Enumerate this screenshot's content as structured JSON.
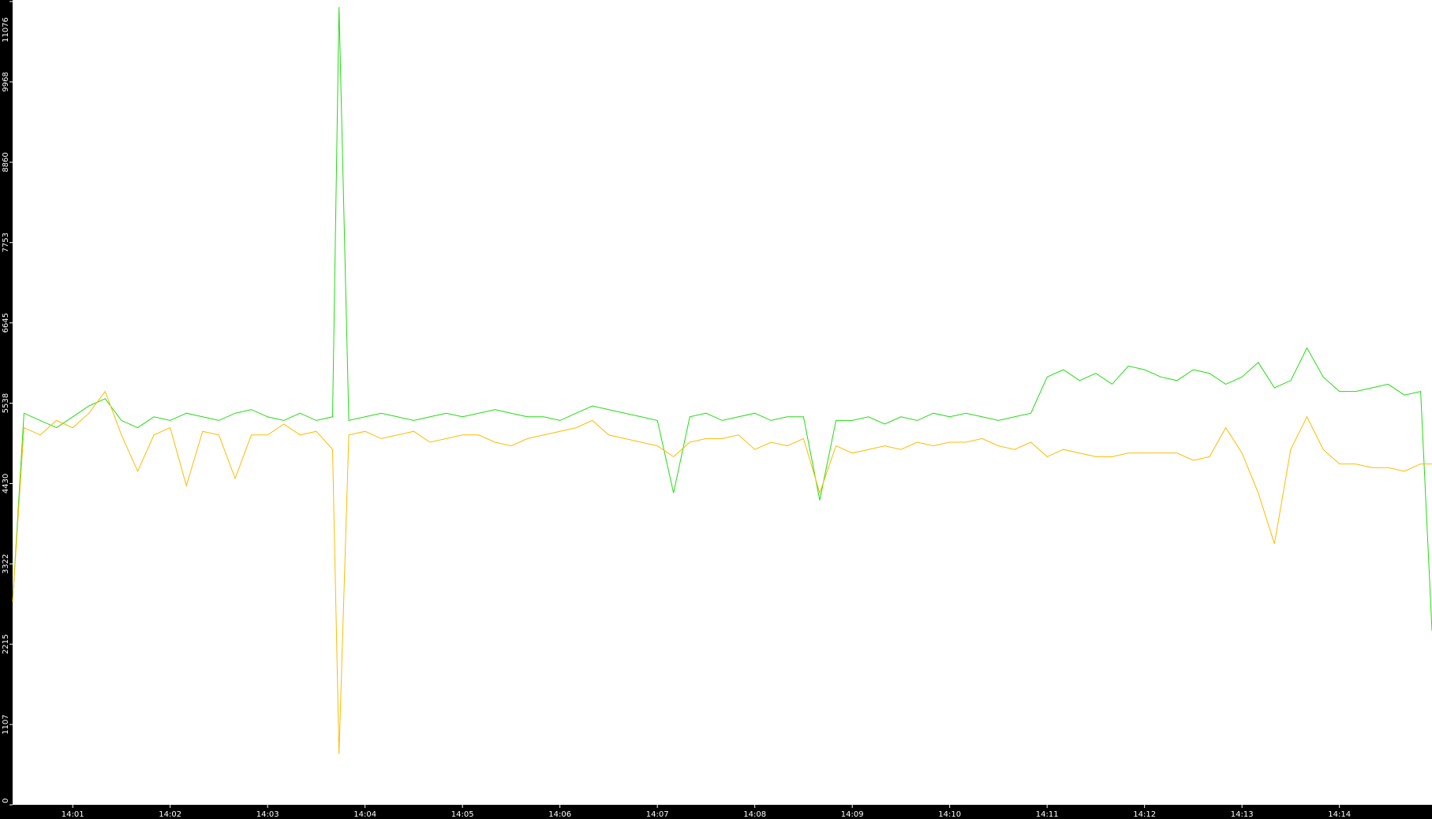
{
  "colors": {
    "background": "#ffffff",
    "axis_band": "#000000",
    "axis_text": "#ffffff",
    "series_green": "#22dd11",
    "series_orange": "#ffbb00"
  },
  "chart_data": {
    "type": "line",
    "title": "",
    "xlabel": "",
    "ylabel": "",
    "grid": false,
    "legend": "none",
    "ylim": [
      0,
      11076
    ],
    "y_ticks": [
      0,
      1107,
      2215,
      3322,
      4430,
      5538,
      6645,
      7753,
      8860,
      9968,
      11076
    ],
    "x_ticks": [
      "14:01",
      "14:02",
      "14:03",
      "14:04",
      "14:05",
      "14:06",
      "14:07",
      "14:08",
      "14:09",
      "14:10",
      "14:11",
      "14:12",
      "14:13",
      "14:14"
    ],
    "xlim": [
      "14:00:23",
      "14:14:57"
    ],
    "x": [
      "14:00:23",
      "14:00:30",
      "14:00:40",
      "14:00:50",
      "14:01:00",
      "14:01:10",
      "14:01:20",
      "14:01:30",
      "14:01:40",
      "14:01:50",
      "14:02:00",
      "14:02:10",
      "14:02:20",
      "14:02:30",
      "14:02:40",
      "14:02:50",
      "14:03:00",
      "14:03:10",
      "14:03:20",
      "14:03:30",
      "14:03:40",
      "14:03:44",
      "14:03:50",
      "14:04:00",
      "14:04:10",
      "14:04:20",
      "14:04:30",
      "14:04:40",
      "14:04:50",
      "14:05:00",
      "14:05:10",
      "14:05:20",
      "14:05:30",
      "14:05:40",
      "14:05:50",
      "14:06:00",
      "14:06:10",
      "14:06:20",
      "14:06:30",
      "14:06:40",
      "14:06:50",
      "14:07:00",
      "14:07:10",
      "14:07:20",
      "14:07:30",
      "14:07:40",
      "14:07:50",
      "14:08:00",
      "14:08:10",
      "14:08:20",
      "14:08:30",
      "14:08:40",
      "14:08:50",
      "14:09:00",
      "14:09:10",
      "14:09:20",
      "14:09:30",
      "14:09:40",
      "14:09:50",
      "14:10:00",
      "14:10:10",
      "14:10:20",
      "14:10:30",
      "14:10:40",
      "14:10:50",
      "14:11:00",
      "14:11:10",
      "14:11:20",
      "14:11:30",
      "14:11:40",
      "14:11:50",
      "14:12:00",
      "14:12:10",
      "14:12:20",
      "14:12:30",
      "14:12:40",
      "14:12:50",
      "14:13:00",
      "14:13:10",
      "14:13:20",
      "14:13:30",
      "14:13:40",
      "14:13:50",
      "14:14:00",
      "14:14:10",
      "14:14:20",
      "14:14:30",
      "14:14:40",
      "14:14:50",
      "14:14:57"
    ],
    "series": [
      {
        "color": "#22dd11",
        "values": [
          2800,
          5400,
          5300,
          5200,
          5350,
          5500,
          5600,
          5300,
          5200,
          5350,
          5300,
          5400,
          5350,
          5300,
          5400,
          5450,
          5350,
          5300,
          5400,
          5300,
          5350,
          11000,
          5300,
          5350,
          5400,
          5350,
          5300,
          5350,
          5400,
          5350,
          5400,
          5450,
          5400,
          5350,
          5350,
          5300,
          5400,
          5500,
          5450,
          5400,
          5350,
          5300,
          4300,
          5350,
          5400,
          5300,
          5350,
          5400,
          5300,
          5350,
          5350,
          4200,
          5300,
          5300,
          5350,
          5250,
          5350,
          5300,
          5400,
          5350,
          5400,
          5350,
          5300,
          5350,
          5400,
          5900,
          6000,
          5850,
          5950,
          5800,
          6050,
          6000,
          5900,
          5850,
          6000,
          5950,
          5800,
          5900,
          6100,
          5750,
          5850,
          6300,
          5900,
          5700,
          5700,
          5750,
          5800,
          5650,
          5700,
          2400
        ]
      },
      {
        "color": "#ffbb00",
        "values": [
          2800,
          5200,
          5100,
          5300,
          5200,
          5400,
          5700,
          5100,
          4600,
          5100,
          5200,
          4400,
          5150,
          5100,
          4500,
          5100,
          5100,
          5250,
          5100,
          5150,
          4900,
          700,
          5100,
          5150,
          5050,
          5100,
          5150,
          5000,
          5050,
          5100,
          5100,
          5000,
          4950,
          5050,
          5100,
          5150,
          5200,
          5300,
          5100,
          5050,
          5000,
          4950,
          4800,
          5000,
          5050,
          5050,
          5100,
          4900,
          5000,
          4950,
          5050,
          4300,
          4950,
          4850,
          4900,
          4950,
          4900,
          5000,
          4950,
          5000,
          5000,
          5050,
          4950,
          4900,
          5000,
          4800,
          4900,
          4850,
          4800,
          4800,
          4850,
          4850,
          4850,
          4850,
          4750,
          4800,
          5200,
          4850,
          4300,
          3600,
          4900,
          5350,
          4900,
          4700,
          4700,
          4650,
          4650,
          4600,
          4700,
          4700
        ]
      }
    ]
  }
}
